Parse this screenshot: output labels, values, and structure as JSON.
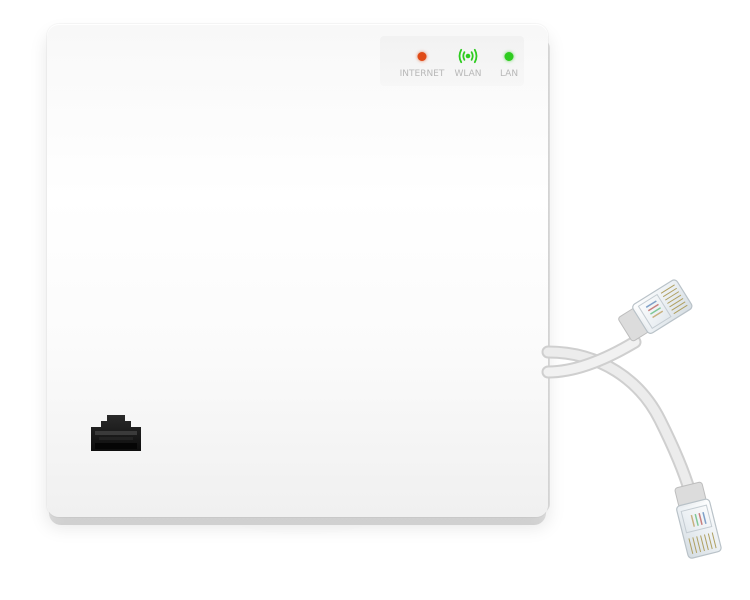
{
  "device": {
    "indicators": [
      {
        "label": "INTERNET",
        "icon": "dot-icon",
        "color": "#e04a16"
      },
      {
        "label": "WLAN",
        "icon": "wifi-signal-icon",
        "color": "#2ecc1f"
      },
      {
        "label": "LAN",
        "icon": "dot-icon",
        "color": "#2ecc1f"
      }
    ],
    "port_icon": "rj45-port-icon",
    "cable_icon": "ethernet-cable-icon",
    "colors": {
      "body": "#ffffff",
      "label": "#b8b8b8",
      "port": "#1a1a1a",
      "cable": "#e6e6e6"
    }
  }
}
